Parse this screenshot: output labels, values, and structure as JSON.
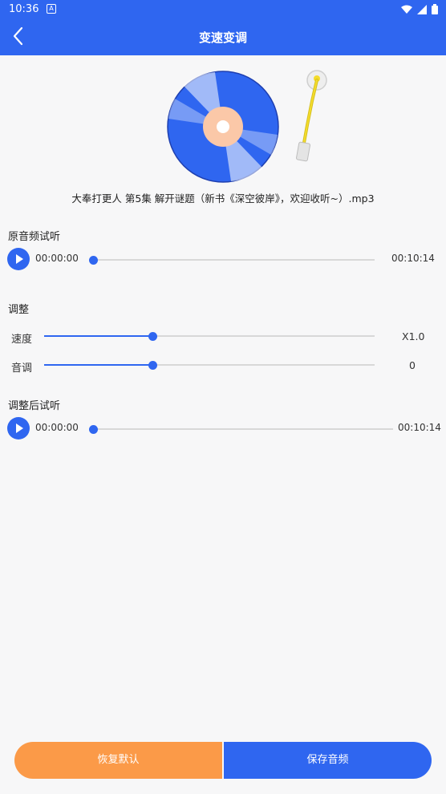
{
  "status_bar": {
    "time": "10:36",
    "notification_icon": "A"
  },
  "app_bar": {
    "title": "变速变调",
    "back_icon": "chevron-left-icon"
  },
  "file": {
    "name": "大奉打更人 第5集 解开谜题（新书《深空彼岸》，欢迎收听~）.mp3"
  },
  "original": {
    "label": "原音频试听",
    "current_time": "00:00:00",
    "total_time": "00:10:14",
    "progress": 0
  },
  "adjust": {
    "label": "调整",
    "speed": {
      "label": "速度",
      "value": "X1.0",
      "level": 0.33
    },
    "pitch": {
      "label": "音调",
      "value": "0",
      "level": 0.33
    }
  },
  "adjusted": {
    "label": "调整后试听",
    "current_time": "00:00:00",
    "total_time": "00:10:14",
    "progress": 0
  },
  "buttons": {
    "reset_label": "恢复默认",
    "save_label": "保存音频"
  },
  "colors": {
    "primary": "#2f66f0",
    "accent": "#fb9a48"
  }
}
